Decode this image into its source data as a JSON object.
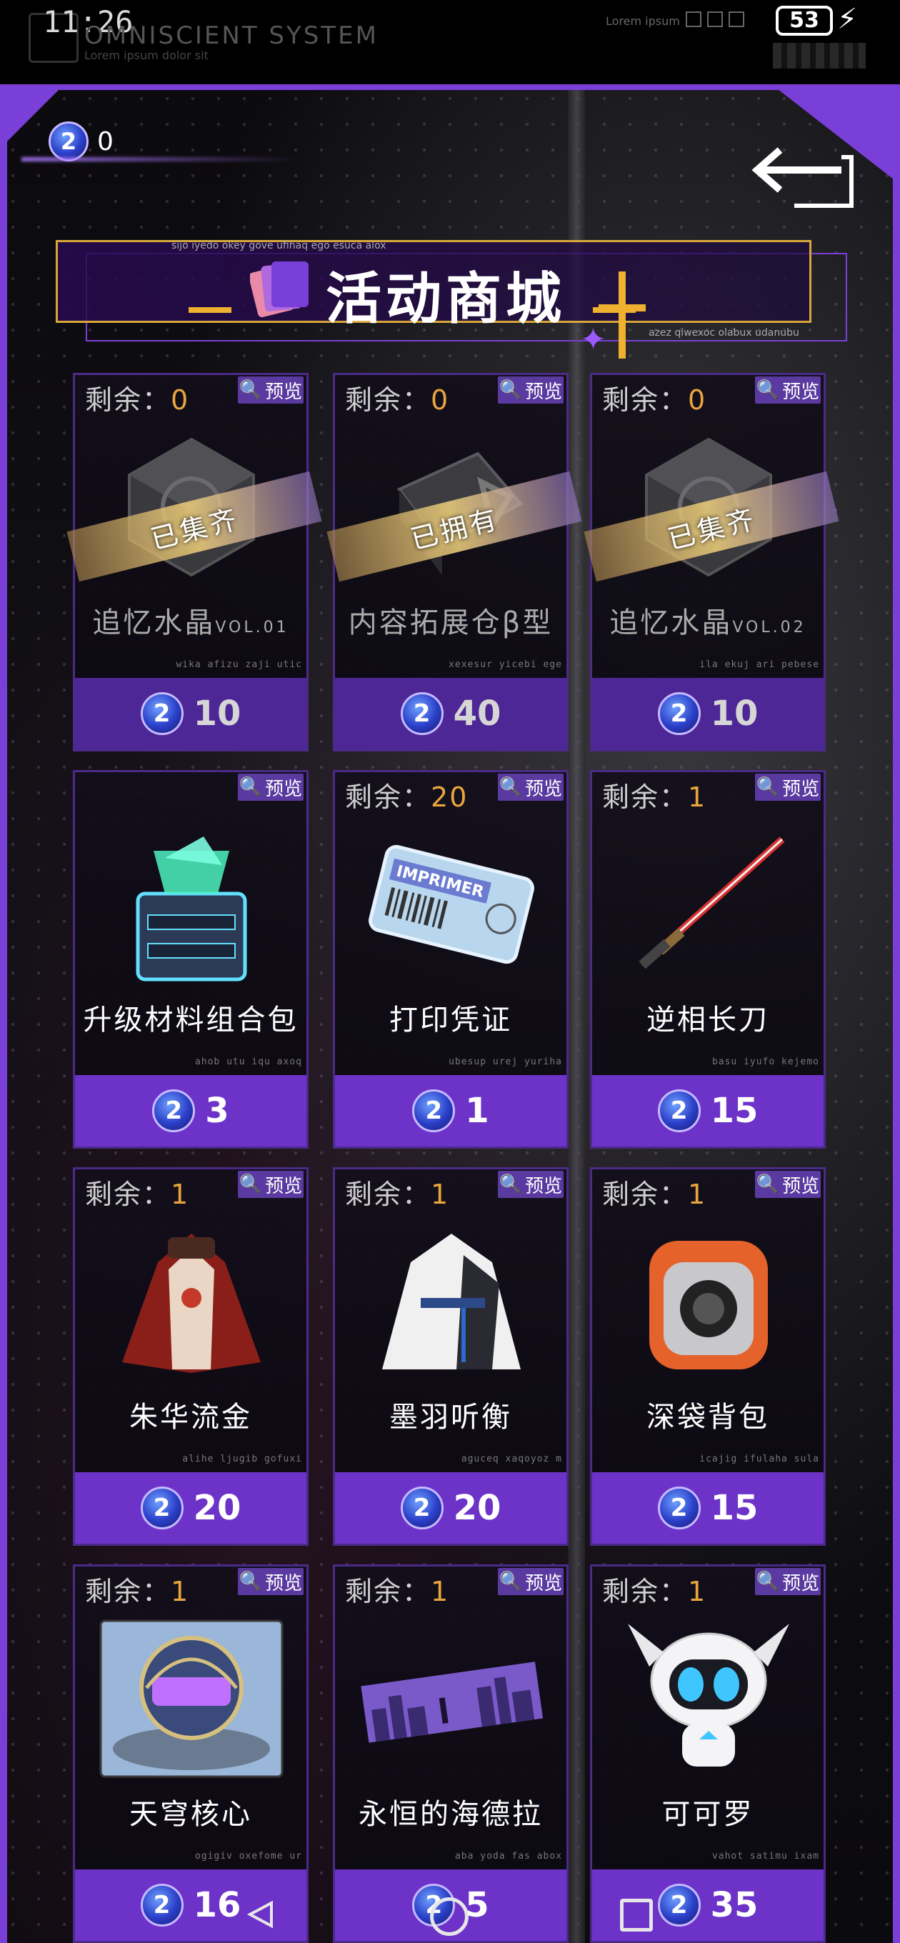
{
  "status_bar": {
    "time": "11:26",
    "app_name": "OMNISCIENT SYSTEM",
    "app_subtitle": "Lorem ipsum dolor sit",
    "small_text": "Lorem ipsum",
    "battery": "53"
  },
  "wallet": {
    "currency_icon": "2",
    "balance": "0"
  },
  "header": {
    "title": "活动商城",
    "top_caption": "sijo iyedo okey gove ufihaq ego esuca alox",
    "bottom_caption": "azez qiwexoc olabux udanubu"
  },
  "labels": {
    "stock_prefix": "剩余：",
    "preview": "预览"
  },
  "items": [
    {
      "stock": "0",
      "name": "追忆水晶",
      "name_suffix": "VOL.01",
      "ribbon": "已集齐",
      "caption": "wika afizu zaji utic",
      "price": "10",
      "owned": true,
      "icon": "crystal-icon"
    },
    {
      "stock": "0",
      "name": "内容拓展仓β型",
      "name_suffix": "",
      "ribbon": "已拥有",
      "caption": "xexesur yicebi ege",
      "price": "40",
      "owned": true,
      "icon": "storage-expansion-icon"
    },
    {
      "stock": "0",
      "name": "追忆水晶",
      "name_suffix": "VOL.02",
      "ribbon": "已集齐",
      "caption": "ila ekuj ari pebese",
      "price": "10",
      "owned": true,
      "icon": "crystal-icon"
    },
    {
      "stock": "",
      "name": "升级材料组合包",
      "name_suffix": "",
      "ribbon": "",
      "caption": "ahob utu iqu axoq",
      "price": "3",
      "owned": false,
      "icon": "material-box-icon"
    },
    {
      "stock": "20",
      "name": "打印凭证",
      "name_suffix": "",
      "ribbon": "",
      "caption": "ubesup urej yuriha",
      "price": "1",
      "owned": false,
      "icon": "print-ticket-icon",
      "ticket_text": "IMPRIMER"
    },
    {
      "stock": "1",
      "name": "逆相长刀",
      "name_suffix": "",
      "ribbon": "",
      "caption": "basu iyufo kejemo",
      "price": "15",
      "owned": false,
      "icon": "long-blade-icon"
    },
    {
      "stock": "1",
      "name": "朱华流金",
      "name_suffix": "",
      "ribbon": "",
      "caption": "alihe ljugib gofuxi",
      "price": "20",
      "owned": false,
      "icon": "red-outfit-icon"
    },
    {
      "stock": "1",
      "name": "墨羽听衡",
      "name_suffix": "",
      "ribbon": "",
      "caption": "aguceq xaqoyoz m",
      "price": "20",
      "owned": false,
      "icon": "white-outfit-icon"
    },
    {
      "stock": "1",
      "name": "深袋背包",
      "name_suffix": "",
      "ribbon": "",
      "caption": "icajig ifulaha sula",
      "price": "15",
      "owned": false,
      "icon": "backpack-icon"
    },
    {
      "stock": "1",
      "name": "天穹核心",
      "name_suffix": "",
      "ribbon": "",
      "caption": "ogigiv oxefome ur",
      "price": "16",
      "owned": false,
      "icon": "sky-core-icon"
    },
    {
      "stock": "1",
      "name": "永恒的海德拉",
      "name_suffix": "",
      "ribbon": "",
      "caption": "aba yoda fas abox",
      "price": "5",
      "owned": false,
      "icon": "city-banner-icon"
    },
    {
      "stock": "1",
      "name": "可可罗",
      "name_suffix": "",
      "ribbon": "",
      "caption": "vahot satimu ixam",
      "price": "35",
      "owned": false,
      "icon": "robot-pet-icon"
    }
  ],
  "colors": {
    "accent_purple": "#6d33c9",
    "frame_purple": "#7a3fd8",
    "gold": "#e9a53d"
  }
}
